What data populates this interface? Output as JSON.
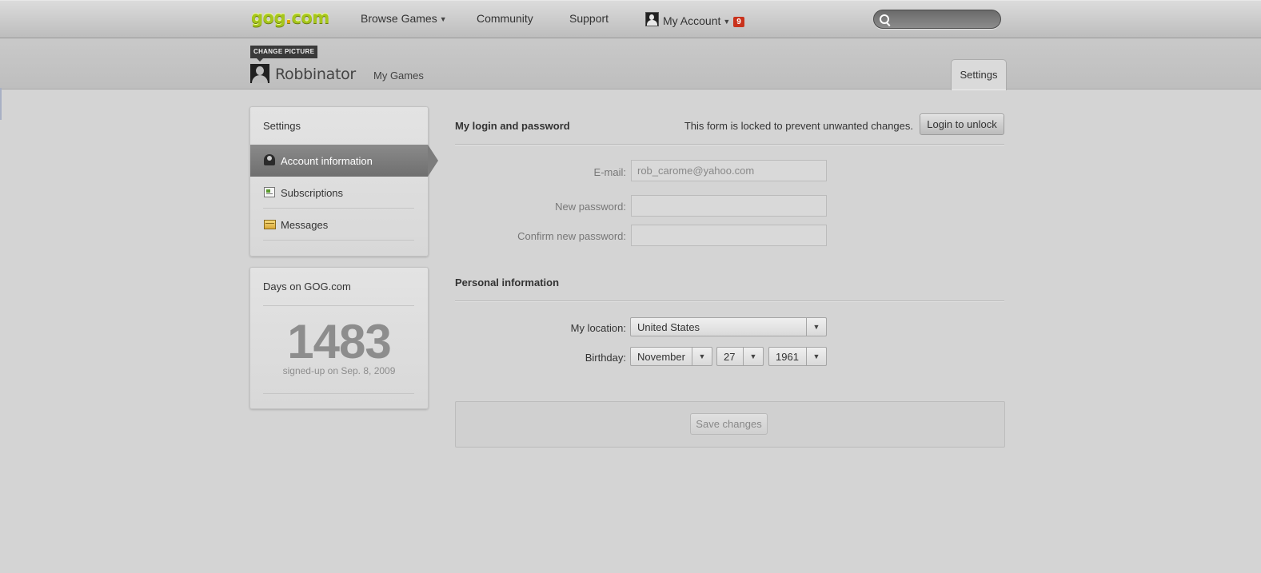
{
  "topnav": {
    "logo_main": "gog",
    "logo_dot": ".",
    "logo_tld": "com",
    "browse_games": "Browse Games",
    "community": "Community",
    "support": "Support",
    "my_account": "My Account",
    "notification_count": "9",
    "search_placeholder": ""
  },
  "profile": {
    "change_picture": "CHANGE PICTURE",
    "username": "Robbinator",
    "my_games": "My Games",
    "settings_tab": "Settings"
  },
  "sidebar": {
    "title": "Settings",
    "items": [
      {
        "label": "Account information",
        "icon": "user-icon",
        "active": true
      },
      {
        "label": "Subscriptions",
        "icon": "subscriptions-icon",
        "active": false
      },
      {
        "label": "Messages",
        "icon": "messages-icon",
        "active": false
      }
    ]
  },
  "days": {
    "title": "Days on GOG.com",
    "count": "1483",
    "signed_up": "signed-up on Sep. 8, 2009"
  },
  "login_section": {
    "title": "My login and password",
    "lock_message": "This form is locked to prevent unwanted changes.",
    "unlock_button": "Login to unlock",
    "email_label": "E-mail:",
    "email_value": "rob_carome@yahoo.com",
    "new_password_label": "New password:",
    "confirm_password_label": "Confirm new password:"
  },
  "personal_section": {
    "title": "Personal information",
    "location_label": "My location:",
    "location_value": "United States",
    "birthday_label": "Birthday:",
    "birthday_month": "November",
    "birthday_day": "27",
    "birthday_year": "1961"
  },
  "save_button": "Save changes",
  "colors": {
    "logo_green": "#a6c61b",
    "logo_dot": "#e3a600",
    "badge_red": "#c9321c",
    "active_menu": "#7c7c7c",
    "page_background": "#d4d4d4"
  }
}
